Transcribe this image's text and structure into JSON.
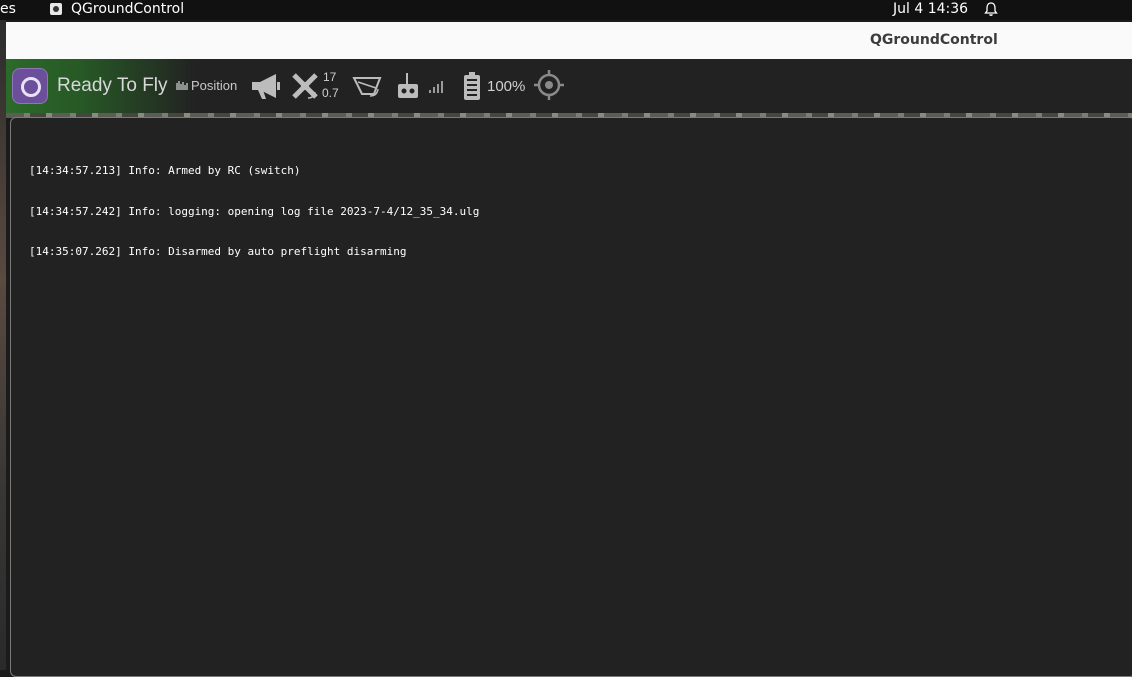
{
  "system_bar": {
    "activities_label": "es",
    "app_name": "QGroundControl",
    "clock": "Jul 4  14:36"
  },
  "window": {
    "title": "QGroundControl"
  },
  "toolbar": {
    "status": "Ready To Fly",
    "flight_mode": "Position",
    "gps": {
      "satellite_count": "17",
      "hdop": "0.7"
    },
    "battery": "100%",
    "icons": [
      "qgc-logo-icon",
      "flight-mode-icon",
      "megaphone-icon",
      "gps-satellite-icon",
      "telemetry-rssi-icon",
      "rc-transmitter-icon",
      "signal-bars-icon",
      "battery-icon",
      "gimbal-target-icon"
    ]
  },
  "console": {
    "messages": [
      "[14:34:57.213] Info: Armed by RC (switch)",
      "[14:34:57.242] Info: logging: opening log file 2023-7-4/12_35_34.ulg",
      "[14:35:07.262] Info: Disarmed by auto preflight disarming"
    ]
  },
  "colors": {
    "toolbar_bg": "#222222",
    "ready_green": "#2c6a2a",
    "console_bg": "#222222",
    "logo_purple": "#6b4f9b"
  }
}
